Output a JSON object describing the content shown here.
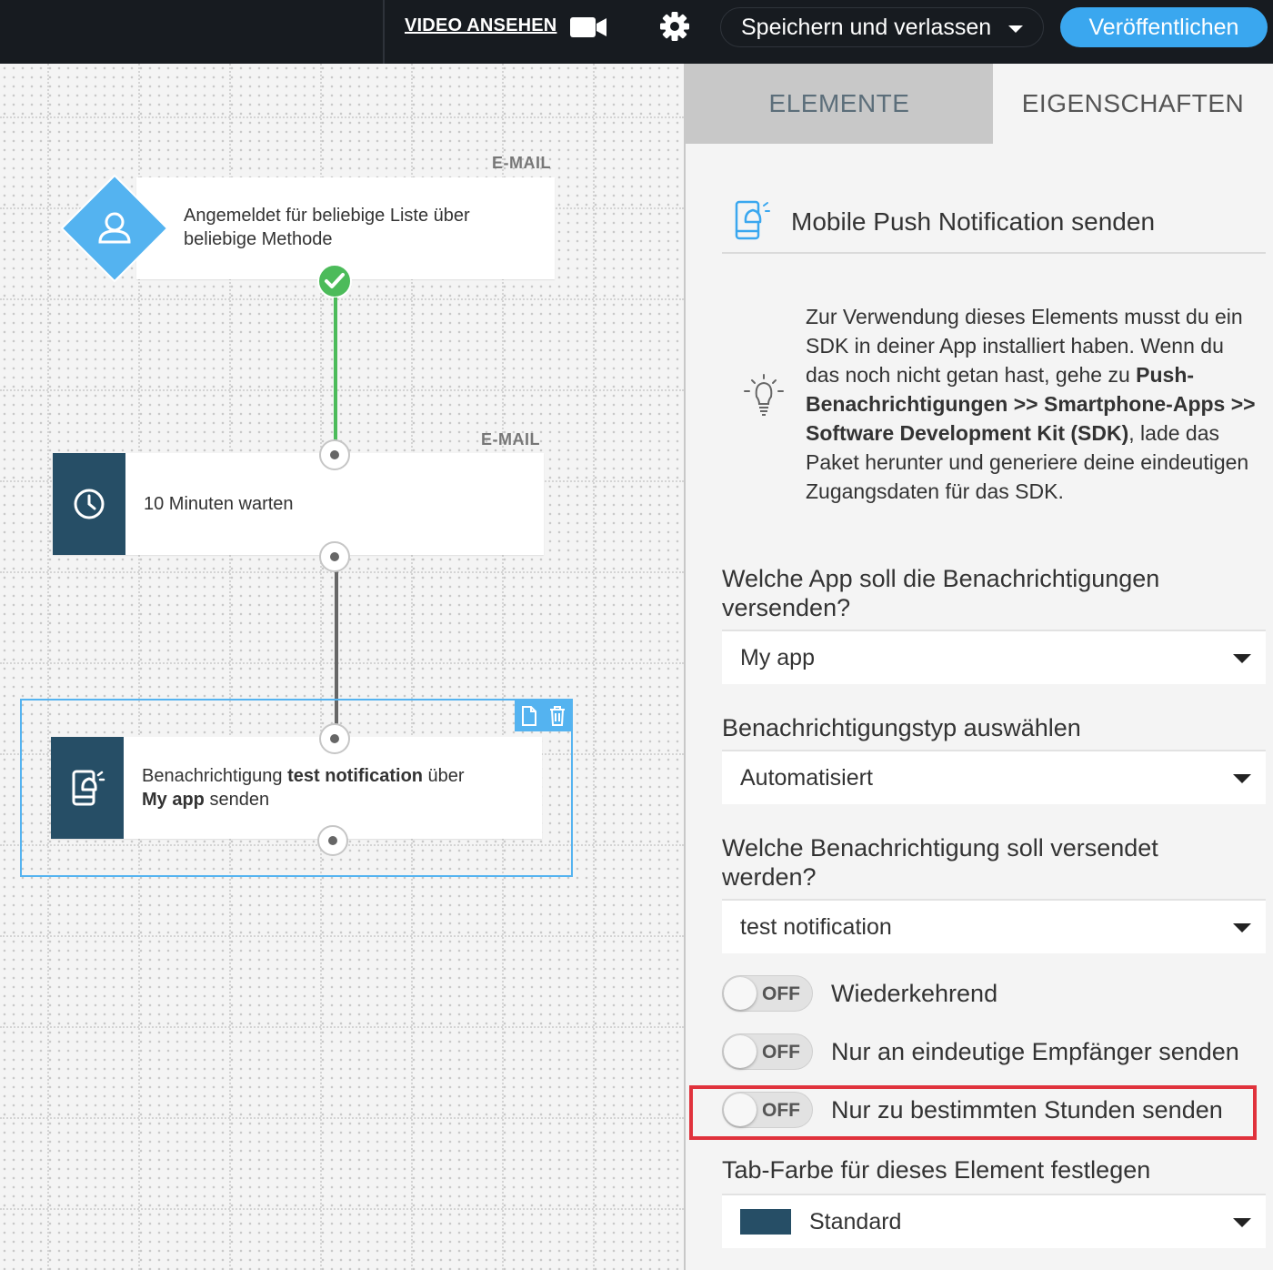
{
  "topbar": {
    "video_label": "VIDEO ANSEHEN",
    "save_label": "Speichern und verlassen",
    "publish_label": "Veröffentlichen",
    "icons": {
      "video": "video-camera-icon",
      "settings": "gear-icon"
    }
  },
  "canvas": {
    "nodes": [
      {
        "tag": "E-MAIL",
        "text": "Angemeldet für beliebige Liste über beliebige Methode",
        "icon": "user-icon"
      },
      {
        "tag": "E-MAIL",
        "text": "10 Minuten warten",
        "icon": "clock-icon"
      },
      {
        "text_pre": "Benachrichtigung ",
        "text_bold1": "test notification",
        "text_mid": " über",
        "text_bold2": "My app",
        "text_post": " senden",
        "icon": "mobile-push-icon"
      }
    ],
    "toolbar_icons": [
      "copy-icon",
      "trash-icon"
    ]
  },
  "panel": {
    "tabs": [
      "ELEMENTE",
      "EIGENSCHAFTEN"
    ],
    "title": "Mobile Push Notification senden",
    "info": {
      "p1": "Zur Verwendung dieses Elements musst du ein SDK in deiner App installiert haben. Wenn du das noch nicht getan hast, gehe zu ",
      "b1": "Push-Benachrichtigungen >> Smartphone-Apps >> Software Development Kit (SDK)",
      "p2": ", lade das Paket herunter und generiere deine eindeutigen Zugangsdaten für das SDK."
    },
    "fields": [
      {
        "label": "Welche App soll die Benachrichtigungen versenden?",
        "value": "My app"
      },
      {
        "label": "Benachrichtigungstyp auswählen",
        "value": "Automatisiert"
      },
      {
        "label": "Welche Benachrichtigung soll versendet werden?",
        "value": "test notification"
      }
    ],
    "toggles": [
      {
        "state": "OFF",
        "label": "Wiederkehrend"
      },
      {
        "state": "OFF",
        "label": "Nur an eindeutige Empfänger senden"
      },
      {
        "state": "OFF",
        "label": "Nur zu bestimmten Stunden senden"
      }
    ],
    "tab_color": {
      "label": "Tab-Farbe für dieses Element festlegen",
      "value": "Standard",
      "swatch_color": "#264e66"
    }
  },
  "colors": {
    "accent": "#3aa7ef",
    "success": "#4cbb5a",
    "node_dark": "#264e66",
    "highlight": "#e0323c"
  }
}
